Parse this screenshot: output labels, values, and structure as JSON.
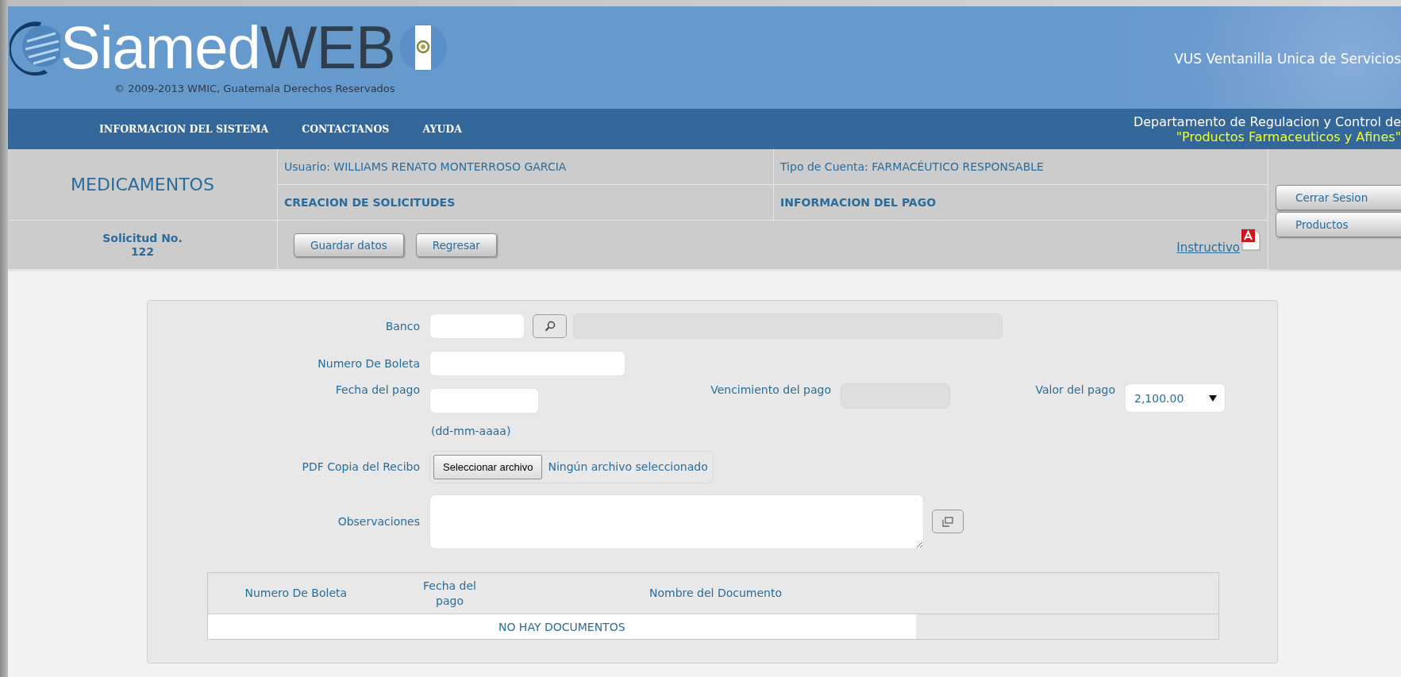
{
  "header": {
    "logo_text": "Siamed",
    "logo_text_2": "WEB",
    "copyright": "© 2009-2013 WMIC, Guatemala Derechos Reservados",
    "tagline": "VUS Ventanilla Unica de Servicios"
  },
  "nav": {
    "items": [
      {
        "label": "INFORMACION DEL SISTEMA"
      },
      {
        "label": "CONTACTANOS"
      },
      {
        "label": "AYUDA"
      }
    ],
    "department": "Departamento de Regulacion y Control de",
    "department_sub": "\"Productos Farmaceuticos y Afines\""
  },
  "info": {
    "module": "MEDICAMENTOS",
    "user": "Usuario: WILLIAMS RENATO MONTERROSO GARCIA",
    "account_type": "Tipo de Cuenta: FARMACÉUTICO RESPONSABLE",
    "section": "CREACION DE SOLICITUDES",
    "subsection": "INFORMACION DEL PAGO",
    "request_label": "Solicitud No.",
    "request_number": "122",
    "actions": [
      "Guardar datos",
      "Regresar"
    ],
    "manual_link": "Instructivo",
    "side_buttons": [
      "Cerrar Sesion",
      "Productos"
    ]
  },
  "form": {
    "bank": {
      "label": "Banco",
      "name_disabled": true
    },
    "receipt_number": {
      "label": "Numero De Boleta"
    },
    "payment_date": {
      "label": "Fecha del pago",
      "hint": "(dd-mm-aaaa)"
    },
    "due_date": {
      "label": "Vencimiento del pago",
      "disabled": true
    },
    "amount": {
      "label": "Valor del pago",
      "value": "2,100.00"
    },
    "file": {
      "label": "PDF Copia del Recibo",
      "button": "Seleccionar archivo",
      "status": "Ningún archivo seleccionado"
    },
    "notes": {
      "label": "Observaciones"
    },
    "table": {
      "columns": [
        "Numero De Boleta",
        "Fecha del pago",
        "Nombre del Documento"
      ],
      "empty_message": "NO HAY DOCUMENTOS"
    }
  }
}
